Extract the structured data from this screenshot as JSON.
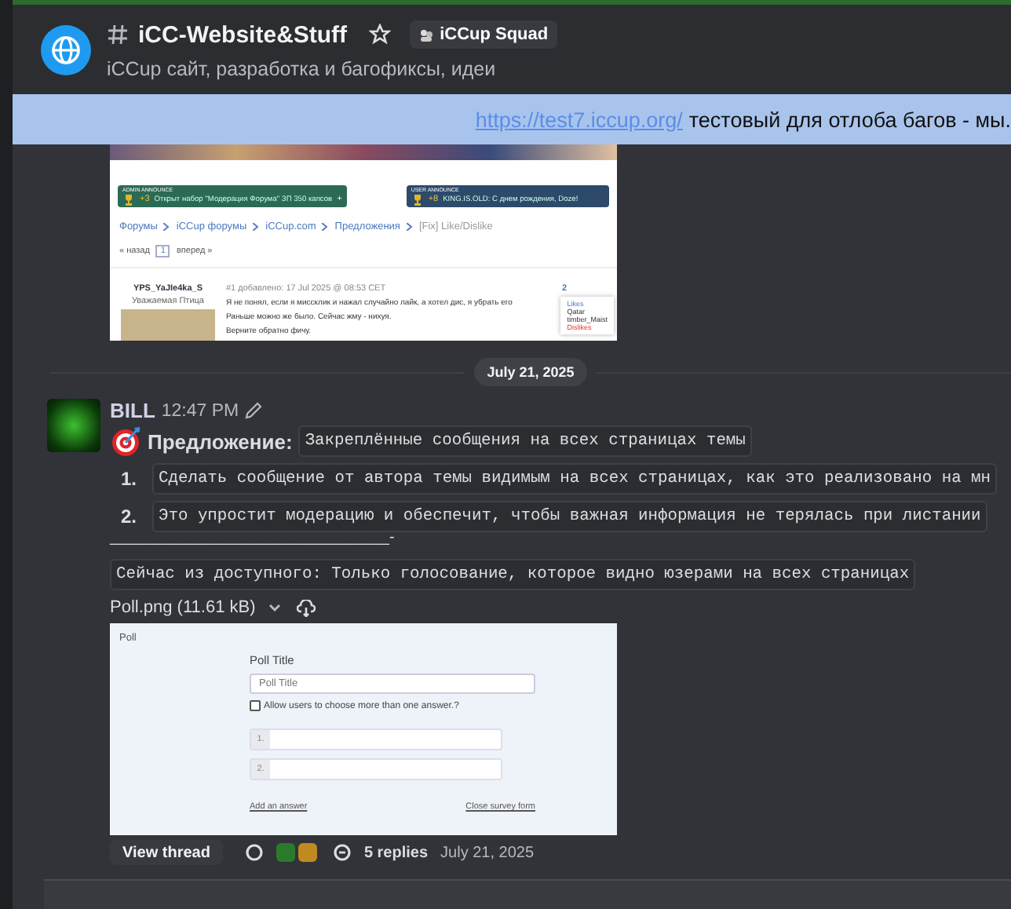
{
  "channel": {
    "name": "iCC-Website&Stuff",
    "server_tag": "iCCup Squad",
    "topic": "iCCup сайт, разработка и багофиксы, идеи"
  },
  "banner": {
    "link": "https://test7.iccup.org/",
    "text": "тестовый для отлоба багов - мы."
  },
  "forum_screenshot": {
    "announcements": [
      {
        "label": "ADMIN ANNOUNCE",
        "points": "+3",
        "text": "Открыт набор \"Модерация Форума\" ЗП 350 капсов",
        "action": "+"
      },
      {
        "label": "USER ANNOUNCE",
        "points": "+8",
        "text": "KING.IS.OLD: С днем рождения, Doze!"
      }
    ],
    "breadcrumbs": [
      "Форумы",
      "iCCup форумы",
      "iCCup.com",
      "Предложения"
    ],
    "current": "[Fix] Like/Dislike",
    "nav": [
      "« назад",
      "1",
      "вперед »"
    ],
    "post": {
      "author": "YPS_YaJIe4ka_S",
      "rank": "Уважаемая Птица",
      "meta": "#1 добавлено: 17 Jul 2025 @ 08:53 CET",
      "lines": [
        "Я не понял, если я миссклик и нажал случайно лайк, а хотел дис, я убрать его",
        "Раньше можно же было. Сейчас жму - нихуя.",
        "Верните обратно фичу."
      ],
      "likes": "2"
    },
    "popup": {
      "likes_label": "Likes",
      "users": [
        "Qatar",
        "timber_Maist"
      ],
      "dislikes_label": "Dislikes"
    }
  },
  "date_divider": "July 21, 2025",
  "message": {
    "author": "BILL",
    "time": "12:47 PM",
    "heading_label": "Предложение:",
    "heading_code": "Закреплённые сообщения на всех страницах темы",
    "items": [
      {
        "number": "1.",
        "text": "Сделать сообщение от автора темы видимым на всех страницах, как это реализовано на мн"
      },
      {
        "number": "2.",
        "text": "Это упростит модерацию и обеспечит, чтобы важная информация не терялась при листании"
      }
    ],
    "separator": "________________________________-",
    "note": "Сейчас из доступного: Только голосование, которое видно юзерами на всех страницах",
    "attachment": "Poll.png (11.61 kB)",
    "poll": {
      "heading": "Poll",
      "title_label": "Poll Title",
      "title_placeholder": "Poll Title",
      "checkbox_label": "Allow users to choose more than one answer.?",
      "checked": false,
      "answers": [
        "1.",
        "2."
      ],
      "add_link": "Add an answer",
      "close_link": "Close survey form"
    }
  },
  "thread": {
    "button": "View thread",
    "summary": "5 replies",
    "date": "July 21, 2025"
  }
}
